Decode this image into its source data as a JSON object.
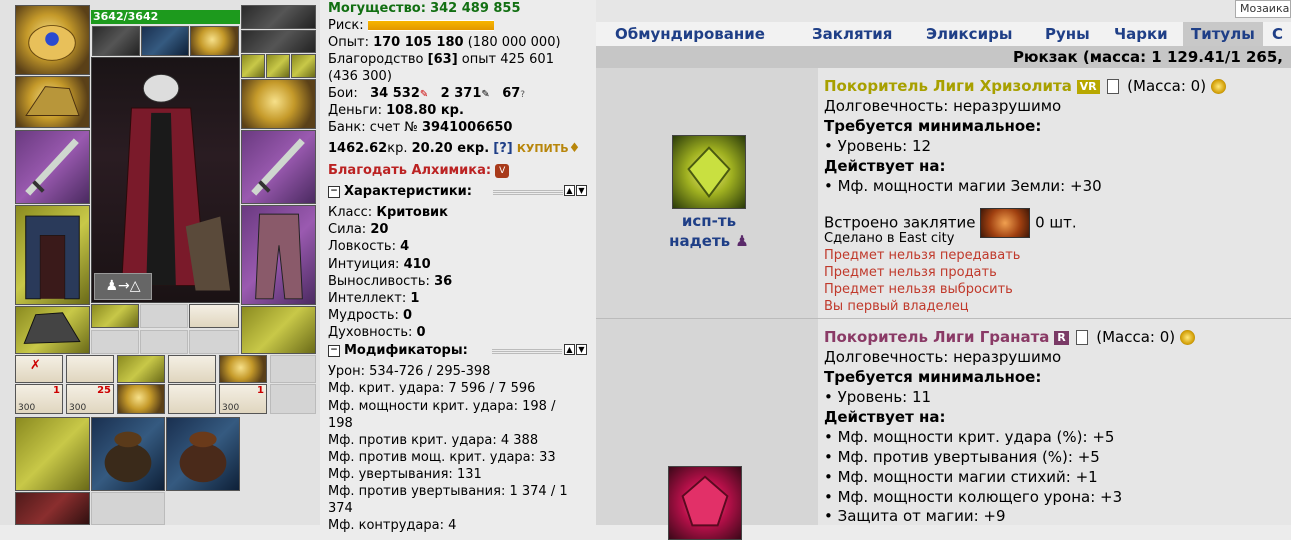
{
  "top": {
    "mosaic_label": "Мозаика"
  },
  "doll": {
    "hp": "3642/3642",
    "slot_counts": {
      "s1": "1",
      "s2": "25",
      "s3": "1"
    },
    "slot_subcounts": {
      "a": "300",
      "b": "300",
      "c": "300"
    }
  },
  "stats": {
    "power_label": "Могущество:",
    "power_value": "342 489 855",
    "risk_label": "Риск:",
    "exp_label": "Опыт:",
    "exp_value": "170 105 180",
    "exp_next": "(180 000 000)",
    "nobility_label": "Благородство",
    "nobility_level": "[63]",
    "nobility_exp": "опыт 425 601",
    "nobility_next": "(436 300)",
    "fights_label": "Бои:",
    "wins": "34 532",
    "losses": "2 371",
    "draws": "67",
    "money_label": "Деньги:",
    "money_value": "108.80 кр.",
    "bank_label": "Банк: счет №",
    "bank_account": "3941006650",
    "bank_cr": "1462.62",
    "bank_cr_unit": "кр.",
    "bank_ekr": "20.20 екр.",
    "help_link": "[?]",
    "buy_label": "КУПИТЬ",
    "blessing": "Благодать Алхимика:",
    "chars_title": "Характеристики:",
    "class_label": "Класс:",
    "class_value": "Критовик",
    "str_label": "Сила:",
    "str_value": "20",
    "agi_label": "Ловкость:",
    "agi_value": "4",
    "int_label": "Интуиция:",
    "int_value": "410",
    "end_label": "Выносливость:",
    "end_value": "36",
    "intel_label": "Интеллект:",
    "intel_value": "1",
    "wis_label": "Мудрость:",
    "wis_value": "0",
    "spi_label": "Духовность:",
    "spi_value": "0",
    "mods_title": "Модификаторы:",
    "mod1": "Урон: 534-726 / 295-398",
    "mod2": "Мф. крит. удара: 7 596 / 7 596",
    "mod3a": "Мф. мощности крит. удара: 198 /",
    "mod3b": "198",
    "mod4": "Мф. против крит. удара: 4 388",
    "mod5": "Мф. против мощ. крит. удара: 33",
    "mod6": "Мф. увертывания: 131",
    "mod7a": "Мф. против увертывания: 1 374 / 1",
    "mod7b": "374",
    "mod8": "Мф. контрудара: 4"
  },
  "tabs": {
    "t1": "Обмундирование",
    "t2": "Заклятия",
    "t3": "Эликсиры",
    "t4": "Руны",
    "t5": "Чарки",
    "t6": "Титулы",
    "t7": "С"
  },
  "bag": {
    "label": "Рюкзак (масса: 1 129.41/1 265,"
  },
  "items": [
    {
      "title": "Покоритель Лиги Хризолита",
      "badge": "VR",
      "badge_color": "#b8a800",
      "title_color": "#a8a000",
      "mass": "(Масса: 0)",
      "durability": "Долговечность: неразрушимо",
      "req_title": "Требуется минимальное:",
      "req_level": "• Уровень: 12",
      "acts_title": "Действует на:",
      "effects": [
        "• Мф. мощности магии Земли: +30"
      ],
      "embedded": "Встроено заклятие",
      "embedded_count": "0 шт.",
      "made_in": "Сделано в East city",
      "restrictions": [
        "Предмет нельзя передавать",
        "Предмет нельзя продать",
        "Предмет нельзя выбросить",
        "Вы первый владелец"
      ],
      "use_label": "исп-ть",
      "wear_label": "надеть"
    },
    {
      "title": "Покоритель Лиги Граната",
      "badge": "R",
      "badge_color": "#7a3a66",
      "title_color": "#8a3a66",
      "mass": "(Масса: 0)",
      "durability": "Долговечность: неразрушимо",
      "req_title": "Требуется минимальное:",
      "req_level": "• Уровень: 11",
      "acts_title": "Действует на:",
      "effects": [
        "• Мф. мощности крит. удара (%): +5",
        "• Мф. против увертывания (%): +5",
        "• Мф. мощности магии стихий: +1",
        "• Мф. мощности колющего урона: +3",
        "• Защита от магии: +9"
      ]
    }
  ]
}
